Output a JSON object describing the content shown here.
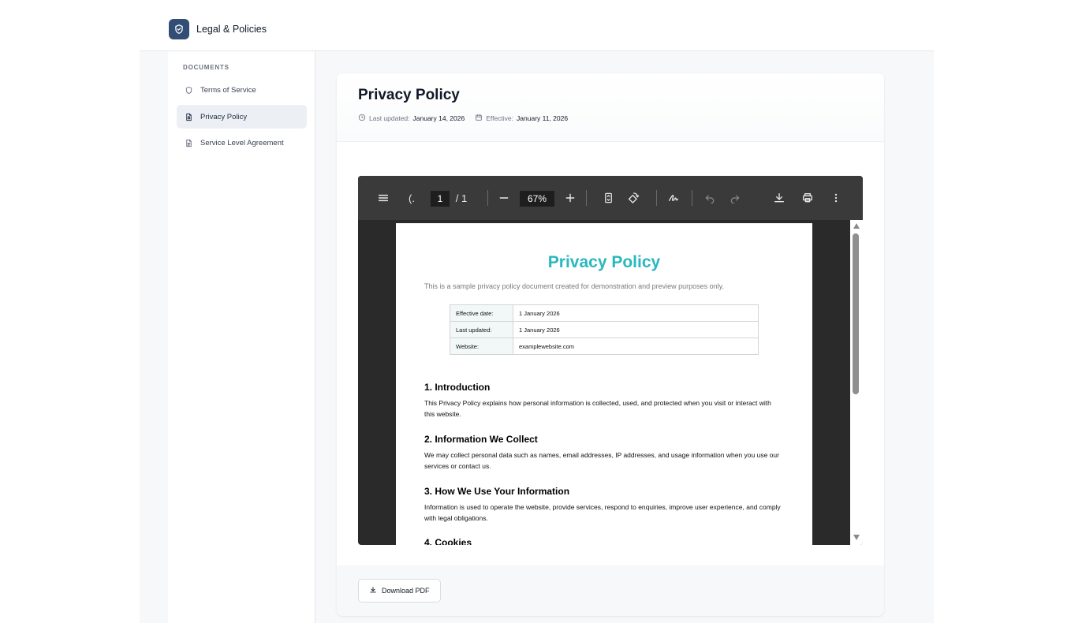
{
  "app": {
    "title": "Legal & Policies",
    "logo_icon": "shield-check-icon",
    "accent": "#334e75"
  },
  "sidebar": {
    "heading": "DOCUMENTS",
    "items": [
      {
        "label": "Terms of Service",
        "icon": "shield-icon",
        "active": false
      },
      {
        "label": "Privacy Policy",
        "icon": "file-lock-icon",
        "active": true
      },
      {
        "label": "Service Level Agreement",
        "icon": "file-text-icon",
        "active": false
      }
    ]
  },
  "document": {
    "title": "Privacy Policy",
    "last_updated_label": "Last updated:",
    "last_updated": "January 14, 2026",
    "effective_label": "Effective:",
    "effective": "January 11, 2026"
  },
  "viewer": {
    "outline_glyph": "(.",
    "page_current": "1",
    "page_total": "/ 1",
    "zoom": "67%"
  },
  "pdf": {
    "title": "Privacy Policy",
    "title_color": "#29b7c0",
    "subtitle": "This is a sample privacy policy document created for demonstration and preview purposes only.",
    "table": [
      {
        "key": "Effective date:",
        "value": "1 January 2026"
      },
      {
        "key": "Last updated:",
        "value": "1 January 2026"
      },
      {
        "key": "Website:",
        "value": "examplewebsite.com"
      }
    ],
    "sections": [
      {
        "heading": "1. Introduction",
        "text": "This Privacy Policy explains how personal information is collected, used, and protected when you visit or interact with this website."
      },
      {
        "heading": "2. Information We Collect",
        "text": "We may collect personal data such as names, email addresses, IP addresses, and usage information when you use our services or contact us."
      },
      {
        "heading": "3. How We Use Your Information",
        "text": "Information is used to operate the website, provide services, respond to enquiries, improve user experience, and comply with legal obligations."
      },
      {
        "heading": "4. Cookies",
        "text": ""
      }
    ]
  },
  "footer": {
    "download_label": "Download PDF"
  }
}
